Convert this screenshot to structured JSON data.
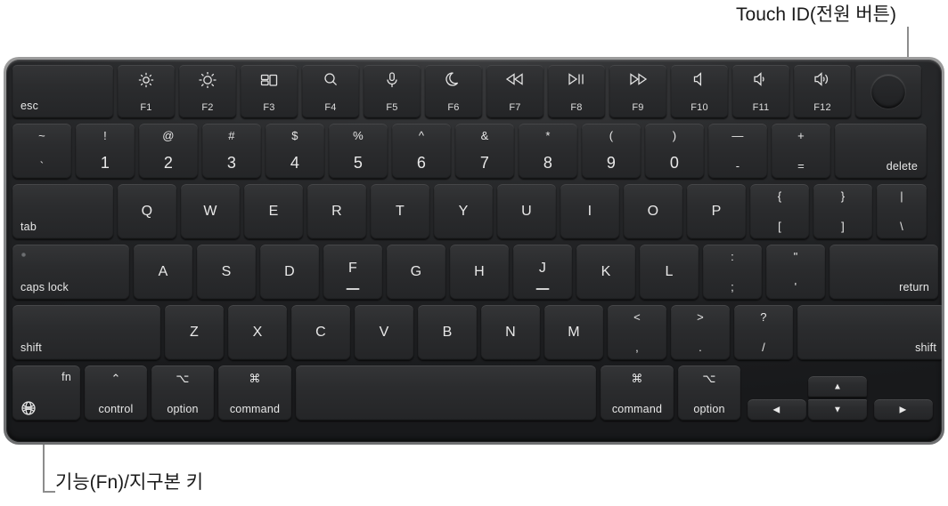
{
  "annotations": {
    "touch_id": "Touch ID(전원 버튼)",
    "fn_globe": "기능(Fn)/지구본 키"
  },
  "colors": {
    "bezel": "#8f9092",
    "deck": "#242527",
    "keycap": "#2b2c2e",
    "legend": "#e8e8e8",
    "leader_line": "#8d8d8d"
  },
  "keyboard": {
    "layout": "Apple Magic Keyboard (US ANSI) with Touch ID",
    "rows": {
      "function_row": [
        {
          "id": "esc",
          "main": "esc",
          "icon": "",
          "sub": ""
        },
        {
          "id": "f1",
          "main": "",
          "icon": "brightness-low",
          "sub": "F1"
        },
        {
          "id": "f2",
          "main": "",
          "icon": "brightness-high",
          "sub": "F2"
        },
        {
          "id": "f3",
          "main": "",
          "icon": "mission-control",
          "sub": "F3"
        },
        {
          "id": "f4",
          "main": "",
          "icon": "spotlight-search",
          "sub": "F4"
        },
        {
          "id": "f5",
          "main": "",
          "icon": "dictation-mic",
          "sub": "F5"
        },
        {
          "id": "f6",
          "main": "",
          "icon": "do-not-disturb",
          "sub": "F6"
        },
        {
          "id": "f7",
          "main": "",
          "icon": "rewind",
          "sub": "F7"
        },
        {
          "id": "f8",
          "main": "",
          "icon": "play-pause",
          "sub": "F8"
        },
        {
          "id": "f9",
          "main": "",
          "icon": "fast-forward",
          "sub": "F9"
        },
        {
          "id": "f10",
          "main": "",
          "icon": "volume-mute",
          "sub": "F10"
        },
        {
          "id": "f11",
          "main": "",
          "icon": "volume-down",
          "sub": "F11"
        },
        {
          "id": "f12",
          "main": "",
          "icon": "volume-up",
          "sub": "F12"
        },
        {
          "id": "touch-id",
          "main": "",
          "icon": "touch-id-circle",
          "sub": ""
        }
      ],
      "number_row": [
        {
          "id": "grave",
          "top": "~",
          "bottom": "`"
        },
        {
          "id": "1",
          "top": "!",
          "bottom": "1"
        },
        {
          "id": "2",
          "top": "@",
          "bottom": "2"
        },
        {
          "id": "3",
          "top": "#",
          "bottom": "3"
        },
        {
          "id": "4",
          "top": "$",
          "bottom": "4"
        },
        {
          "id": "5",
          "top": "%",
          "bottom": "5"
        },
        {
          "id": "6",
          "top": "^",
          "bottom": "6"
        },
        {
          "id": "7",
          "top": "&",
          "bottom": "7"
        },
        {
          "id": "8",
          "top": "*",
          "bottom": "8"
        },
        {
          "id": "9",
          "top": "(",
          "bottom": "9"
        },
        {
          "id": "0",
          "top": ")",
          "bottom": "0"
        },
        {
          "id": "minus",
          "top": "—",
          "bottom": "-"
        },
        {
          "id": "equal",
          "top": "+",
          "bottom": "="
        },
        {
          "id": "delete",
          "top": "",
          "bottom": "",
          "word": "delete"
        }
      ],
      "top_letter_row": [
        {
          "id": "tab",
          "word": "tab"
        },
        {
          "id": "q",
          "letter": "Q"
        },
        {
          "id": "w",
          "letter": "W"
        },
        {
          "id": "e",
          "letter": "E"
        },
        {
          "id": "r",
          "letter": "R"
        },
        {
          "id": "t",
          "letter": "T"
        },
        {
          "id": "y",
          "letter": "Y"
        },
        {
          "id": "u",
          "letter": "U"
        },
        {
          "id": "i",
          "letter": "I"
        },
        {
          "id": "o",
          "letter": "O"
        },
        {
          "id": "p",
          "letter": "P"
        },
        {
          "id": "bracket-left",
          "top": "{",
          "bottom": "["
        },
        {
          "id": "bracket-right",
          "top": "}",
          "bottom": "]"
        },
        {
          "id": "backslash",
          "top": "|",
          "bottom": "\\"
        }
      ],
      "home_row": [
        {
          "id": "caps-lock",
          "word": "caps lock",
          "led": true
        },
        {
          "id": "a",
          "letter": "A"
        },
        {
          "id": "s",
          "letter": "S"
        },
        {
          "id": "d",
          "letter": "D"
        },
        {
          "id": "f",
          "letter": "F",
          "homing": true
        },
        {
          "id": "g",
          "letter": "G"
        },
        {
          "id": "h",
          "letter": "H"
        },
        {
          "id": "j",
          "letter": "J",
          "homing": true
        },
        {
          "id": "k",
          "letter": "K"
        },
        {
          "id": "l",
          "letter": "L"
        },
        {
          "id": "semicolon",
          "top": ":",
          "bottom": ";"
        },
        {
          "id": "quote",
          "top": "\"",
          "bottom": "'"
        },
        {
          "id": "return",
          "word": "return"
        }
      ],
      "shift_row": [
        {
          "id": "shift-left",
          "word": "shift"
        },
        {
          "id": "z",
          "letter": "Z"
        },
        {
          "id": "x",
          "letter": "X"
        },
        {
          "id": "c",
          "letter": "C"
        },
        {
          "id": "v",
          "letter": "V"
        },
        {
          "id": "b",
          "letter": "B"
        },
        {
          "id": "n",
          "letter": "N"
        },
        {
          "id": "m",
          "letter": "M"
        },
        {
          "id": "comma",
          "top": "<",
          "bottom": ","
        },
        {
          "id": "period",
          "top": ">",
          "bottom": "."
        },
        {
          "id": "slash",
          "top": "?",
          "bottom": "/"
        },
        {
          "id": "shift-right",
          "word": "shift"
        }
      ],
      "bottom_row": [
        {
          "id": "fn-globe",
          "corner": "fn",
          "icon": "globe",
          "word": ""
        },
        {
          "id": "control",
          "symbol": "⌃",
          "word": "control"
        },
        {
          "id": "option-left",
          "symbol": "⌥",
          "word": "option"
        },
        {
          "id": "command-left",
          "symbol": "⌘",
          "word": "command"
        },
        {
          "id": "space",
          "word": ""
        },
        {
          "id": "command-right",
          "symbol": "⌘",
          "word": "command"
        },
        {
          "id": "option-right",
          "symbol": "⌥",
          "word": "option"
        },
        {
          "id": "arrow-left",
          "glyph": "◀"
        },
        {
          "id": "arrow-up",
          "glyph": "▲"
        },
        {
          "id": "arrow-down",
          "glyph": "▼"
        },
        {
          "id": "arrow-right",
          "glyph": "▶"
        }
      ]
    }
  }
}
